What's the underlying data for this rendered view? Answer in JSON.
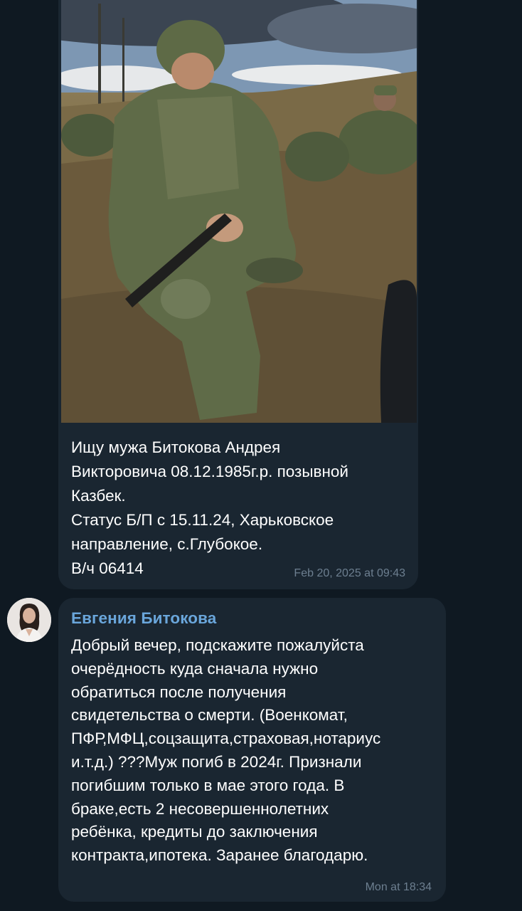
{
  "messages": [
    {
      "photo": {
        "description_icon": "soldier-photo"
      },
      "caption": "Ищу мужа Битокова Андрея\nВикторовича 08.12.1985г.р. позывной\nКазбек.\nСтатус Б/П с 15.11.24, Харьковское\nнаправление, с.Глубокое.\nВ/ч 06414",
      "time": "Feb 20, 2025 at 09:43"
    },
    {
      "sender": "Евгения Битокова",
      "text": "Добрый вечер, подскажите пожалуйста\nочерёдность куда сначала  нужно\nобратиться  после получения\nсвидетельства о  смерти. (Военкомат,\nПФР,МФЦ,соцзащита,страховая,нотариус\nи.т.д.) ???Муж погиб в 2024г. Признали\nпогибшим только  в мае этого года. В\nбраке,есть 2 несовершеннолетних\nребёнка, кредиты до заключения\nконтракта,ипотека. Заранее  благодарю.",
      "time": "Mon at 18:34"
    }
  ],
  "colors": {
    "background": "#0f1922",
    "bubble": "#1a2631",
    "sender_name": "#6aa6db",
    "timestamp": "#6d7f90"
  }
}
